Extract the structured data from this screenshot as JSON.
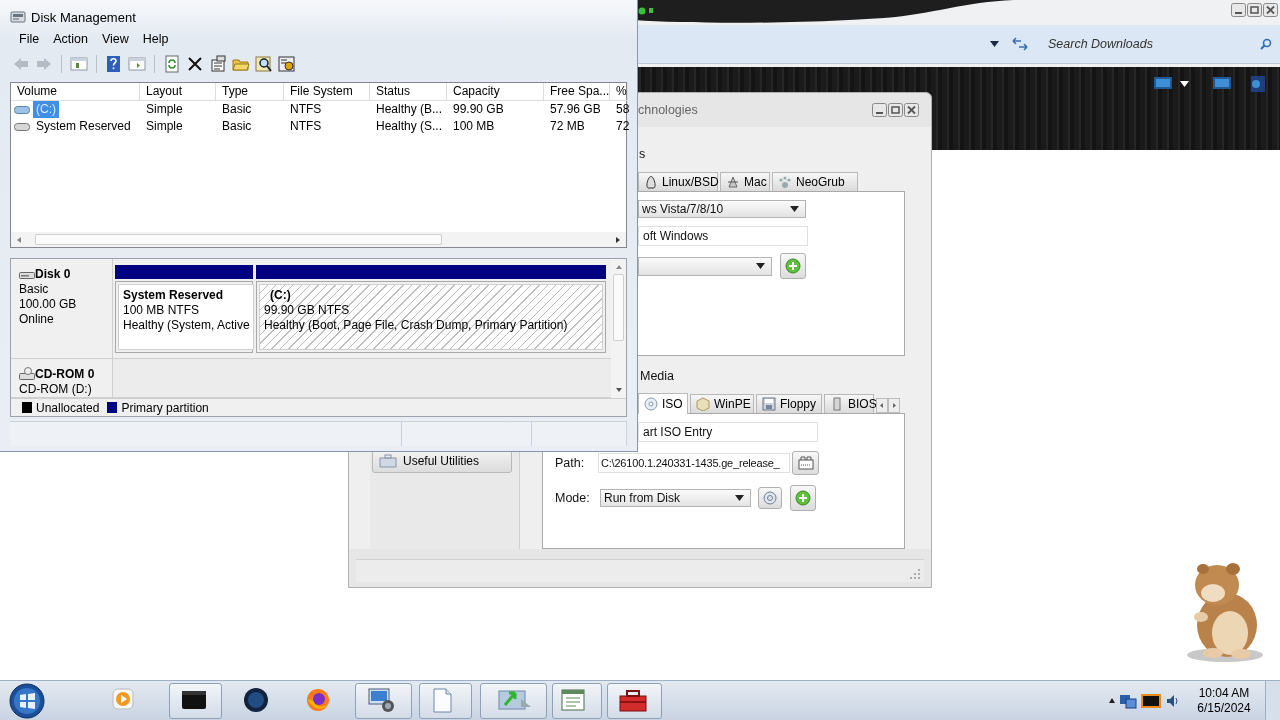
{
  "explorer": {
    "search_placeholder": "Search Downloads"
  },
  "easybcd": {
    "title": "chnologies",
    "sidebar": [
      "Useful Utilities"
    ],
    "bootloader_group": {
      "label": "s",
      "tabs": [
        {
          "label": "Linux/BSD",
          "selected": false
        },
        {
          "label": "Mac",
          "selected": false
        },
        {
          "label": "NeoGrub",
          "selected": false
        }
      ],
      "type_dropdown": "ws Vista/7/8/10",
      "name_field": "oft Windows"
    },
    "media_group": {
      "label": "Media",
      "tabs": [
        {
          "label": "ISO",
          "selected": true
        },
        {
          "label": "WinPE",
          "selected": false
        },
        {
          "label": "Floppy",
          "selected": false
        },
        {
          "label": "BIOS",
          "selected": false
        }
      ],
      "name_field": "art ISO Entry",
      "path_label": "Path:",
      "path_value": "C:\\26100.1.240331-1435.ge_release_",
      "mode_label": "Mode:",
      "mode_value": "Run from Disk"
    }
  },
  "disk_management": {
    "title": "Disk Management",
    "menu": [
      "File",
      "Action",
      "View",
      "Help"
    ],
    "volume_table": {
      "columns": [
        "Volume",
        "Layout",
        "Type",
        "File System",
        "Status",
        "Capacity",
        "Free Spa...",
        "%"
      ],
      "rows": [
        {
          "selected": true,
          "cells": [
            "(C:)",
            "Simple",
            "Basic",
            "NTFS",
            "Healthy (B...",
            "99.90 GB",
            "57.96 GB",
            "58"
          ]
        },
        {
          "selected": false,
          "cells": [
            "System Reserved",
            "Simple",
            "Basic",
            "NTFS",
            "Healthy (S...",
            "100 MB",
            "72 MB",
            "72"
          ]
        }
      ]
    },
    "disks": [
      {
        "kind": "disk",
        "name": "Disk 0",
        "details": [
          "Basic",
          "100.00 GB",
          "Online"
        ],
        "partitions": [
          {
            "name": "System Reserved",
            "size": "100 MB NTFS",
            "status": "Healthy (System, Active",
            "selected": false
          },
          {
            "name": "(C:)",
            "size": "99.90 GB NTFS",
            "status": "Healthy (Boot, Page File, Crash Dump, Primary Partition)",
            "selected": true
          }
        ]
      },
      {
        "kind": "cdrom",
        "name": "CD-ROM 0",
        "details": [
          "CD-ROM (D:)"
        ]
      }
    ],
    "legend": [
      {
        "label": "Unallocated",
        "color": "#000000"
      },
      {
        "label": "Primary partition",
        "color": "#000080"
      }
    ]
  },
  "taskbar": {
    "clock": {
      "time": "10:04 AM",
      "date": "6/15/2024"
    }
  }
}
